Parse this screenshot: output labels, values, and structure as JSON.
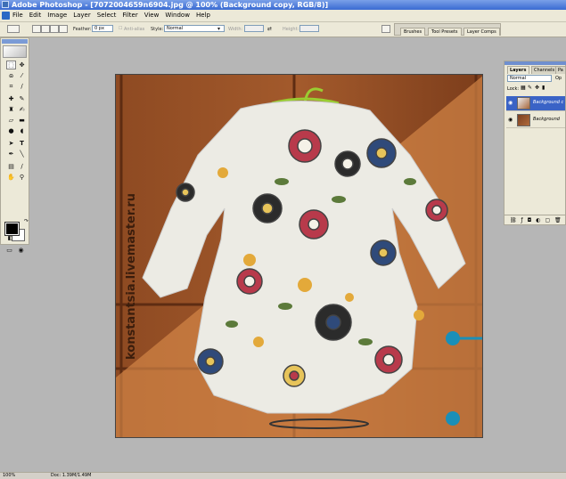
{
  "title_bar": {
    "text": "Adobe Photoshop - [7072004659n6904.jpg @ 100% (Background copy, RGB/8)]"
  },
  "menu": {
    "items": [
      "File",
      "Edit",
      "Image",
      "Layer",
      "Select",
      "Filter",
      "View",
      "Window",
      "Help"
    ]
  },
  "options": {
    "feather_label": "Feather:",
    "feather_value": "0 px",
    "antialias_label": "Anti-alias",
    "style_label": "Style:",
    "style_value": "Normal",
    "width_label": "Width:",
    "height_label": "Height:"
  },
  "well_tabs": [
    "Brushes",
    "Tool Presets",
    "Layer Comps"
  ],
  "canvas": {
    "watermark": "konstantsia.livemaster.ru"
  },
  "layers_panel": {
    "tabs": [
      "Layers",
      "Channels",
      "Pa"
    ],
    "blend_mode": "Normal",
    "opacity_label": "Op",
    "lock_label": "Lock:",
    "layers": [
      {
        "name": "Background c",
        "selected": true
      },
      {
        "name": "Background",
        "selected": false
      }
    ]
  },
  "status": {
    "zoom": "100%",
    "doc": "Doc: 1.39M/1.49M"
  },
  "icons": {
    "marquee": "rect-marquee-icon",
    "move": "move-icon",
    "lasso": "lasso-icon",
    "magic_wand": "magic-wand-icon",
    "crop": "crop-icon",
    "eyedropper": "eyedropper-icon",
    "heal": "healing-icon",
    "brush": "brush-icon",
    "stamp": "clone-stamp-icon",
    "history_brush": "history-brush-icon",
    "eraser": "eraser-icon",
    "gradient": "gradient-icon",
    "blur": "blur-icon",
    "dodge": "dodge-icon",
    "path_select": "path-select-icon",
    "type": "type-icon",
    "pen": "pen-icon",
    "shape": "shape-icon",
    "notes": "notes-icon",
    "eyedropper2": "eyedropper-icon",
    "hand": "hand-icon",
    "zoom": "zoom-icon"
  },
  "colors": {
    "titlebar": "#3a6bd2",
    "chrome": "#ece9d8",
    "workspace": "#b6b6b6",
    "selection": "#3a63c6"
  }
}
